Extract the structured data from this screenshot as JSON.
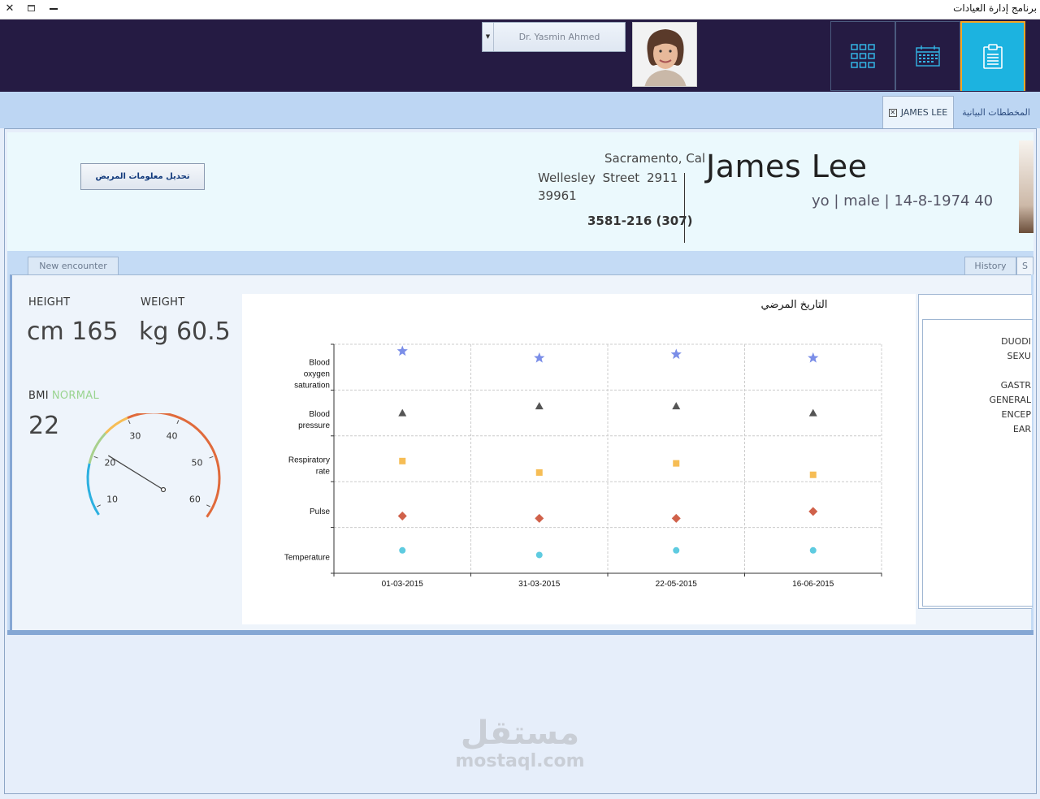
{
  "window": {
    "title": "برنامج إدارة العيادات",
    "close": "✕",
    "maximize": "🗖",
    "minimize": "—"
  },
  "header": {
    "doctor": "Dr. Yasmin Ahmed",
    "buttons": [
      "grid-icon",
      "calendar-icon",
      "clipboard-icon"
    ],
    "active_button": "clipboard-icon"
  },
  "tabs": {
    "patient": "JAMES LEE",
    "charts": "المخططات البيانية"
  },
  "patient": {
    "edit_button": "تحديل معلومات المريض",
    "city": "Sacramento, Cal",
    "street": "Wellesley  Street  2911",
    "zip": "39961",
    "phone": "3581-216 (307)",
    "name": "James Lee",
    "info": "yo | male | 14-8-1974 40"
  },
  "inner_tabs": {
    "new_encounter": "New encounter",
    "history": "History",
    "s": "S"
  },
  "vitals": {
    "height_label": "HEIGHT",
    "height_value": "cm 165",
    "weight_label": "WEIGHT",
    "weight_value": "kg 60.5",
    "bmi_label": "BMI",
    "bmi_status": "NORMAL",
    "bmi_value": "22",
    "gauge": {
      "min": 5,
      "max": 65,
      "value": 22,
      "ticks": [
        10,
        20,
        30,
        40,
        50,
        60
      ]
    }
  },
  "chart_data": {
    "type": "scatter",
    "title": "التاريخ المرضي",
    "categories": [
      "Temperature",
      "Pulse",
      "Respiratory rate",
      "Blood pressure",
      "Blood oxygen saturation"
    ],
    "x": [
      "01-03-2015",
      "31-03-2015",
      "22-05-2015",
      "16-06-2015"
    ],
    "series": [
      {
        "name": "Blood oxygen saturation",
        "marker": "star",
        "color": "#7b8ee8",
        "values": [
          4.85,
          4.7,
          4.78,
          4.7
        ]
      },
      {
        "name": "Blood pressure",
        "marker": "triangle",
        "color": "#555555",
        "values": [
          3.5,
          3.65,
          3.65,
          3.5
        ]
      },
      {
        "name": "Respiratory rate",
        "marker": "square",
        "color": "#f6bd55",
        "values": [
          2.45,
          2.2,
          2.4,
          2.15
        ]
      },
      {
        "name": "Pulse",
        "marker": "diamond",
        "color": "#d0614a",
        "values": [
          1.25,
          1.2,
          1.2,
          1.35
        ]
      },
      {
        "name": "Temperature",
        "marker": "circle",
        "color": "#5ecbe0",
        "values": [
          0.5,
          0.4,
          0.5,
          0.5
        ]
      }
    ],
    "ylim": [
      0,
      5
    ],
    "grid": true
  },
  "diagnoses": [
    "DUODI",
    "SEXU",
    "",
    "GASTR",
    "GENERAL",
    "ENCEP",
    "EAR"
  ],
  "watermark": {
    "arabic": "مستقل",
    "latin": "mostaql.com"
  }
}
